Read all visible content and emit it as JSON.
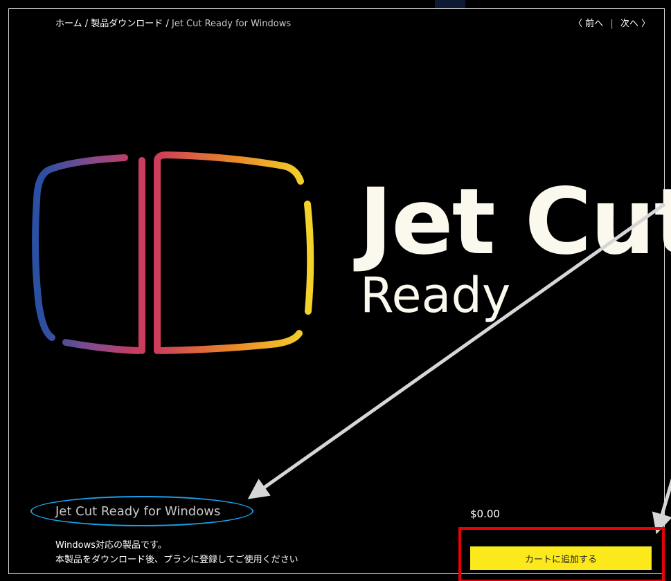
{
  "breadcrumb": {
    "home": "ホーム",
    "sep1": "/",
    "category": "製品ダウンロード",
    "sep2": "/",
    "current": "Jet Cut Ready for Windows"
  },
  "pager": {
    "prev": "〈 前へ",
    "divider": "|",
    "next": "次へ 〉"
  },
  "hero": {
    "title": "Jet Cut",
    "subtitle": "Ready"
  },
  "product": {
    "name": "Jet Cut Ready for Windows",
    "price": "$0.00",
    "description_line1": "Windows対応の製品です。",
    "description_line2": "本製品をダウンロード後、プランに登録してご使用ください",
    "add_to_cart_label": "カートに追加する"
  },
  "colors": {
    "background": "#000000",
    "accent_button": "#fbe91c",
    "highlight_box": "#e8000b",
    "highlight_ellipse": "#1ca0e8",
    "logo_blue": "#2a4fa3",
    "logo_red": "#cc3c5c",
    "logo_orange": "#e8842a",
    "logo_yellow": "#f3d229"
  }
}
